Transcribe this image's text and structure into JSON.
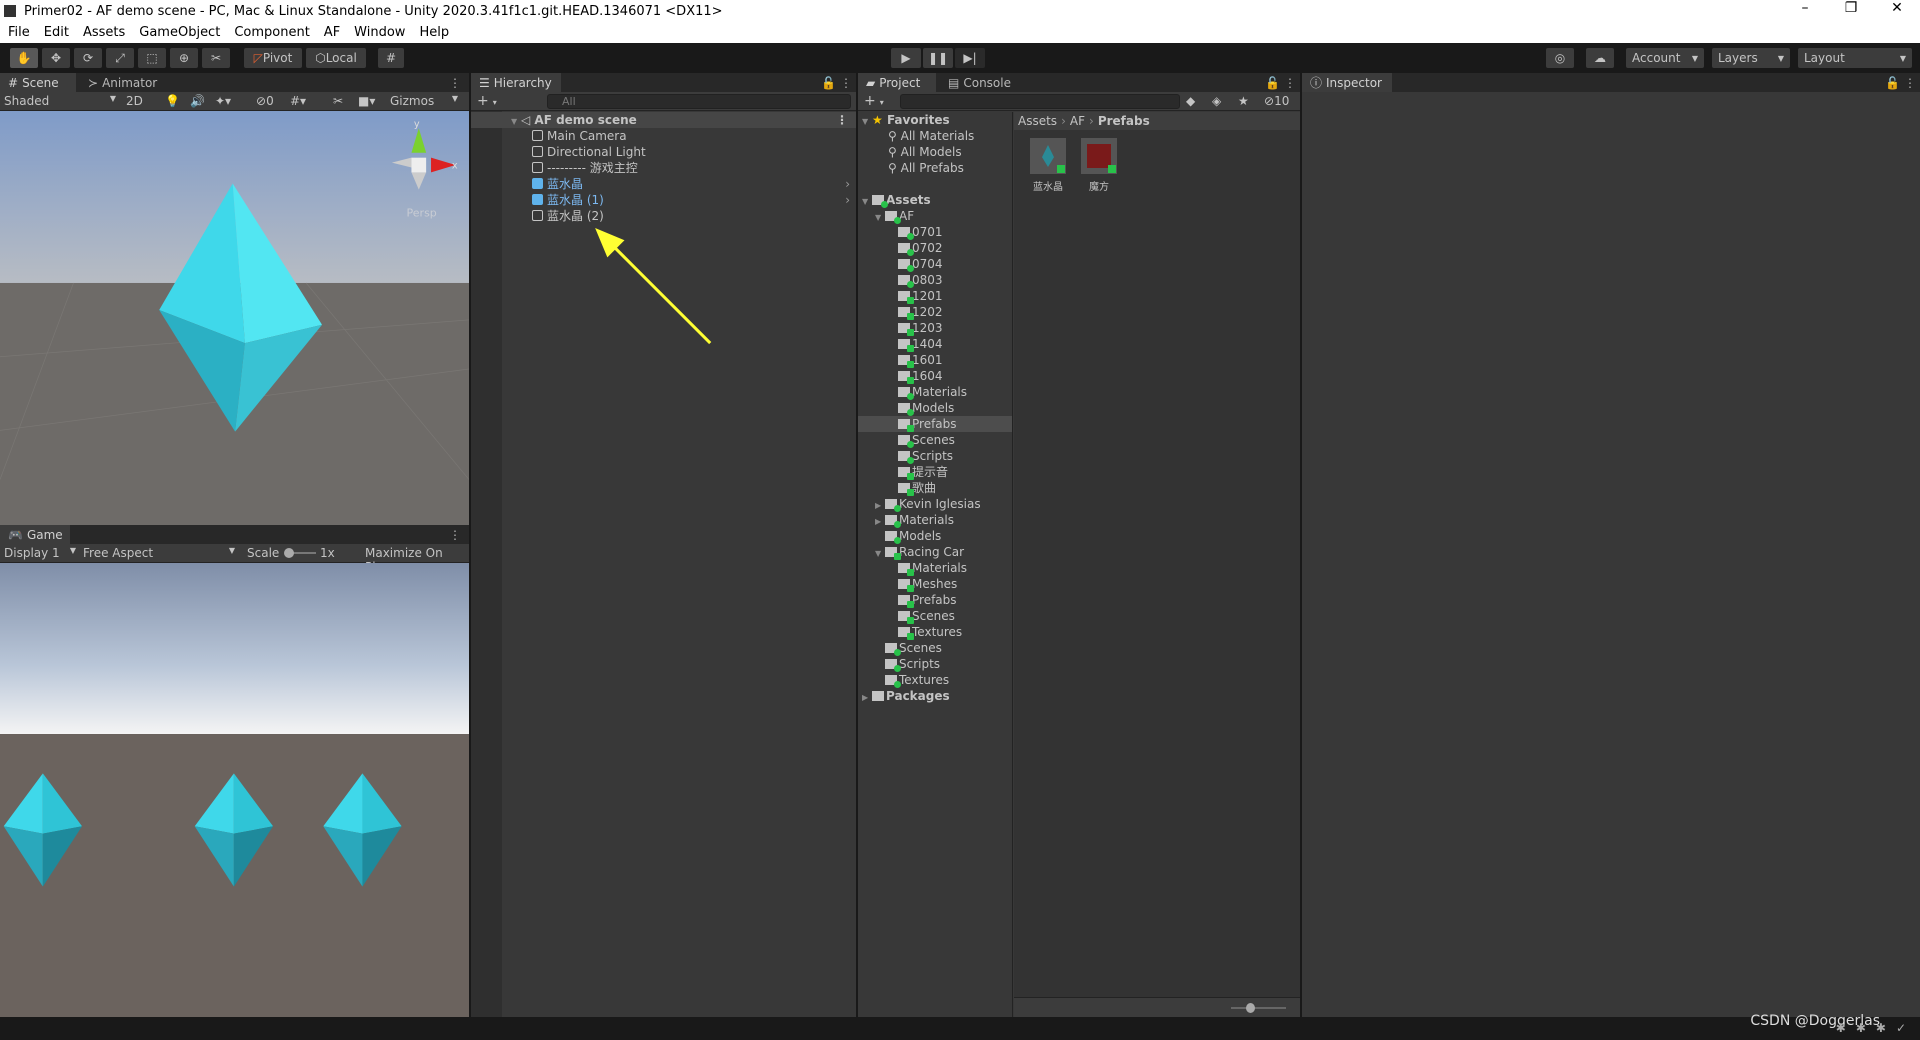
{
  "window": {
    "title": "Primer02 - AF demo scene - PC, Mac & Linux Standalone - Unity 2020.3.41f1c1.git.HEAD.1346071 <DX11>"
  },
  "menu": [
    "File",
    "Edit",
    "Assets",
    "GameObject",
    "Component",
    "AF",
    "Window",
    "Help"
  ],
  "toolbar": {
    "pivot": "Pivot",
    "local": "Local",
    "account": "Account",
    "layers": "Layers",
    "layout": "Layout"
  },
  "scene": {
    "tab": "Scene",
    "tab2": "Animator",
    "shading": "Shaded",
    "mode2d": "2D",
    "hidden_count": "0",
    "gizmos": "Gizmos",
    "persp": "Persp",
    "axis_y": "y",
    "axis_x": "x"
  },
  "game": {
    "tab": "Game",
    "display": "Display 1",
    "aspect": "Free Aspect",
    "scale_label": "Scale",
    "scale_value": "1x",
    "scale_level": 0,
    "maximize": "Maximize On Play"
  },
  "hierarchy": {
    "tab": "Hierarchy",
    "search_placeholder": "All",
    "scene_name": "AF demo scene",
    "items": [
      {
        "label": "Main Camera",
        "prefab": false
      },
      {
        "label": "Directional Light",
        "prefab": false
      },
      {
        "label": "--------- 游戏主控",
        "prefab": false
      },
      {
        "label": "蓝水晶",
        "prefab": true
      },
      {
        "label": "蓝水晶 (1)",
        "prefab": true
      },
      {
        "label": "蓝水晶 (2)",
        "prefab": false
      }
    ]
  },
  "project": {
    "tab": "Project",
    "tab2": "Console",
    "hidden_count": "10",
    "favorites": {
      "label": "Favorites",
      "items": [
        "All Materials",
        "All Models",
        "All Prefabs"
      ]
    },
    "tree": [
      {
        "label": "Assets",
        "depth": 0,
        "arrow": "open",
        "bold": true,
        "badge": "plus"
      },
      {
        "label": "AF",
        "depth": 1,
        "arrow": "open",
        "badge": "plus"
      },
      {
        "label": "0701",
        "depth": 2,
        "badge": "plus"
      },
      {
        "label": "0702",
        "depth": 2,
        "badge": "plus"
      },
      {
        "label": "0704",
        "depth": 2,
        "badge": "plus"
      },
      {
        "label": "0803",
        "depth": 2,
        "badge": "plus"
      },
      {
        "label": "1201",
        "depth": 2,
        "badge": "check"
      },
      {
        "label": "1202",
        "depth": 2,
        "badge": "check"
      },
      {
        "label": "1203",
        "depth": 2,
        "badge": "check"
      },
      {
        "label": "1404",
        "depth": 2,
        "badge": "check"
      },
      {
        "label": "1601",
        "depth": 2,
        "badge": "check"
      },
      {
        "label": "1604",
        "depth": 2,
        "badge": "check"
      },
      {
        "label": "Materials",
        "depth": 2,
        "badge": "plus"
      },
      {
        "label": "Models",
        "depth": 2,
        "badge": "plus"
      },
      {
        "label": "Prefabs",
        "depth": 2,
        "badge": "check",
        "selected": true
      },
      {
        "label": "Scenes",
        "depth": 2,
        "badge": "plus"
      },
      {
        "label": "Scripts",
        "depth": 2,
        "badge": "plus"
      },
      {
        "label": "提示音",
        "depth": 2,
        "badge": "check"
      },
      {
        "label": "歌曲",
        "depth": 2,
        "badge": "check"
      },
      {
        "label": "Kevin Iglesias",
        "depth": 1,
        "arrow": "closed",
        "badge": "plus"
      },
      {
        "label": "Materials",
        "depth": 1,
        "arrow": "closed",
        "badge": "plus"
      },
      {
        "label": "Models",
        "depth": 1,
        "badge": "plus"
      },
      {
        "label": "Racing Car",
        "depth": 1,
        "arrow": "open",
        "badge": "check"
      },
      {
        "label": "Materials",
        "depth": 2,
        "badge": "check"
      },
      {
        "label": "Meshes",
        "depth": 2,
        "badge": "check"
      },
      {
        "label": "Prefabs",
        "depth": 2,
        "badge": "check"
      },
      {
        "label": "Scenes",
        "depth": 2,
        "badge": "check"
      },
      {
        "label": "Textures",
        "depth": 2,
        "badge": "check"
      },
      {
        "label": "Scenes",
        "depth": 1,
        "badge": "plus"
      },
      {
        "label": "Scripts",
        "depth": 1,
        "badge": "plus"
      },
      {
        "label": "Textures",
        "depth": 1,
        "badge": "plus"
      },
      {
        "label": "Packages",
        "depth": 0,
        "arrow": "closed",
        "bold": true,
        "badge": "none"
      }
    ],
    "breadcrumb": [
      "Assets",
      "AF",
      "Prefabs"
    ],
    "assets": [
      {
        "label": "蓝水晶",
        "color": "#2a8a96"
      },
      {
        "label": "魔方",
        "color": "#7a1a1a"
      }
    ],
    "zoom_level": 0.3
  },
  "inspector": {
    "tab": "Inspector"
  },
  "status": {
    "watermark": "CSDN @Doggerlas"
  },
  "colors": {
    "crystal": "#4de3f0",
    "arrow": "#ffff33",
    "selected_prefab": "#5fb3ec"
  }
}
